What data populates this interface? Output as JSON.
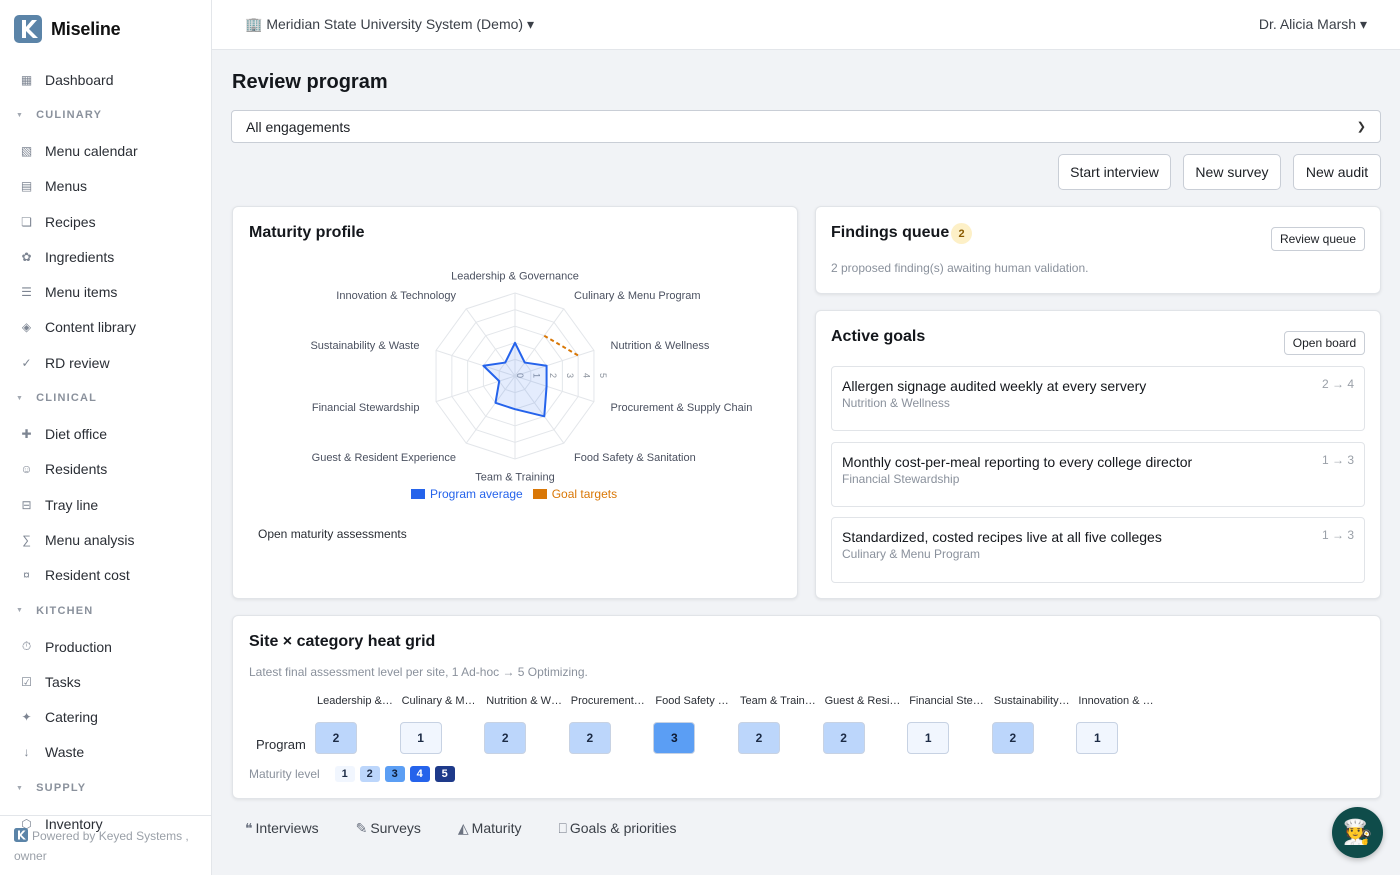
{
  "app": {
    "name": "Miseline"
  },
  "topbar": {
    "org": "🏢 Meridian State University System (Demo) ▾",
    "user": "Dr. Alicia Marsh ▾"
  },
  "sidebar": {
    "items": [
      {
        "icon": "▦",
        "label": "Dashboard"
      },
      {
        "section": "CULINARY"
      },
      {
        "icon": "▧",
        "label": "Menu calendar"
      },
      {
        "icon": "▤",
        "label": "Menus"
      },
      {
        "icon": "❏",
        "label": "Recipes"
      },
      {
        "icon": "✿",
        "label": "Ingredients"
      },
      {
        "icon": "☰",
        "label": "Menu items"
      },
      {
        "icon": "◈",
        "label": "Content library"
      },
      {
        "icon": "✓",
        "label": "RD review"
      },
      {
        "section": "CLINICAL"
      },
      {
        "icon": "✚",
        "label": "Diet office"
      },
      {
        "icon": "☺",
        "label": "Residents"
      },
      {
        "icon": "⊟",
        "label": "Tray line"
      },
      {
        "icon": "∑",
        "label": "Menu analysis"
      },
      {
        "icon": "¤",
        "label": "Resident cost"
      },
      {
        "section": "KITCHEN"
      },
      {
        "icon": "⏱",
        "label": "Production"
      },
      {
        "icon": "☑",
        "label": "Tasks"
      },
      {
        "icon": "✦",
        "label": "Catering"
      },
      {
        "icon": "↓",
        "label": "Waste"
      },
      {
        "section": "SUPPLY"
      },
      {
        "icon": "⬡",
        "label": "Inventory"
      }
    ],
    "footer_line1": "Powered by Keyed Systems ,",
    "footer_line2": "owner"
  },
  "main": {
    "title": "Review program",
    "filter": {
      "value": "All engagements"
    },
    "actions": {
      "start_interview": "Start interview",
      "new_survey": "New survey",
      "new_audit": "New audit"
    }
  },
  "maturity_card": {
    "title": "Maturity profile",
    "open_link": "Open maturity assessments",
    "legend": {
      "program": "Program average",
      "goals": "Goal targets"
    },
    "colors": {
      "program": "#2563eb",
      "goals": "#d97706"
    }
  },
  "chart_data": {
    "type": "radar",
    "axes": [
      "Leadership & Governance",
      "Culinary & Menu Program",
      "Nutrition & Wellness",
      "Procurement & Supply Chain",
      "Food Safety & Sanitation",
      "Team & Training",
      "Guest & Resident Experience",
      "Financial Stewardship",
      "Sustainability & Waste",
      "Innovation & Technology"
    ],
    "scale_ticks": [
      "0",
      "1",
      "2",
      "3",
      "4",
      "5"
    ],
    "range": [
      0,
      5
    ],
    "series": [
      {
        "name": "Program average",
        "values": [
          2,
          1,
          2,
          2,
          3,
          2,
          2,
          1,
          2,
          1
        ]
      },
      {
        "name": "Goal targets",
        "values": [
          null,
          3,
          4,
          null,
          null,
          null,
          null,
          null,
          null,
          null
        ]
      }
    ]
  },
  "findings": {
    "title": "Findings queue",
    "count": "2",
    "button": "Review queue",
    "text": "2 proposed finding(s) awaiting human validation."
  },
  "goals": {
    "title": "Active goals",
    "button": "Open board",
    "items": [
      {
        "title": "Allergen signage audited weekly at every servery",
        "category": "Nutrition & Wellness",
        "range": "2 → 4"
      },
      {
        "title": "Monthly cost-per-meal reporting to every college director",
        "category": "Financial Stewardship",
        "range": "1 → 3"
      },
      {
        "title": "Standardized, costed recipes live at all five colleges",
        "category": "Culinary & Menu Program",
        "range": "1 → 3"
      }
    ]
  },
  "heat": {
    "title": "Site × category heat grid",
    "subtitle": "Latest final assessment level per site, 1 Ad-hoc → 5 Optimizing.",
    "columns": [
      "Leadership &…",
      "Culinary & M…",
      "Nutrition & W…",
      "Procurement…",
      "Food Safety …",
      "Team & Train…",
      "Guest & Resi…",
      "Financial Ste…",
      "Sustainability…",
      "Innovation & …"
    ],
    "row_label": "Program",
    "values": [
      "2",
      "1",
      "2",
      "2",
      "3",
      "2",
      "2",
      "1",
      "2",
      "1"
    ],
    "levels": [
      2,
      1,
      2,
      2,
      3,
      2,
      2,
      1,
      2,
      1
    ],
    "scale_label": "Maturity level",
    "scale": [
      "1",
      "2",
      "3",
      "4",
      "5"
    ]
  },
  "bottom_tabs": [
    {
      "icon": "❝",
      "label": "Interviews"
    },
    {
      "icon": "✎",
      "label": "Surveys"
    },
    {
      "icon": "◭",
      "label": "Maturity"
    },
    {
      "icon": "⎕",
      "label": "Goals & priorities"
    }
  ],
  "fab": {
    "icon": "🧑‍🍳"
  }
}
